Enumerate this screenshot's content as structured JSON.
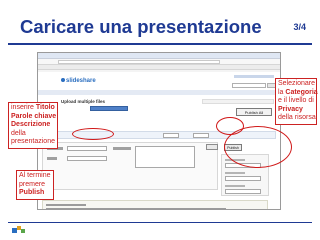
{
  "slide": {
    "title": "Caricare una presentazione",
    "page_number": "3/4"
  },
  "browser": {
    "site_logo": "slideshare",
    "upload_title": "Upload multiple files",
    "publish_all_label": "Publish All",
    "publish_label": "Publish"
  },
  "callouts": {
    "left": {
      "line1": "inserire ",
      "line1_bold": "Titolo",
      "line2_bold": "Parole chiave",
      "line3_bold": "Descrizione",
      "line4": "della",
      "line5": "presentazione"
    },
    "right": {
      "line1": "Selezionare",
      "line2": "la ",
      "line2_bold": "Categoria",
      "line3": "e il livello di",
      "line4_bold": "Privacy",
      "line5": "della risorsa"
    },
    "bottom": {
      "line1": "Al termine",
      "line2": "premere",
      "line3_bold": "Publish"
    }
  },
  "colors": {
    "title": "#1f3a93",
    "callout": "#cc2222",
    "ellipse": "#d01818"
  }
}
